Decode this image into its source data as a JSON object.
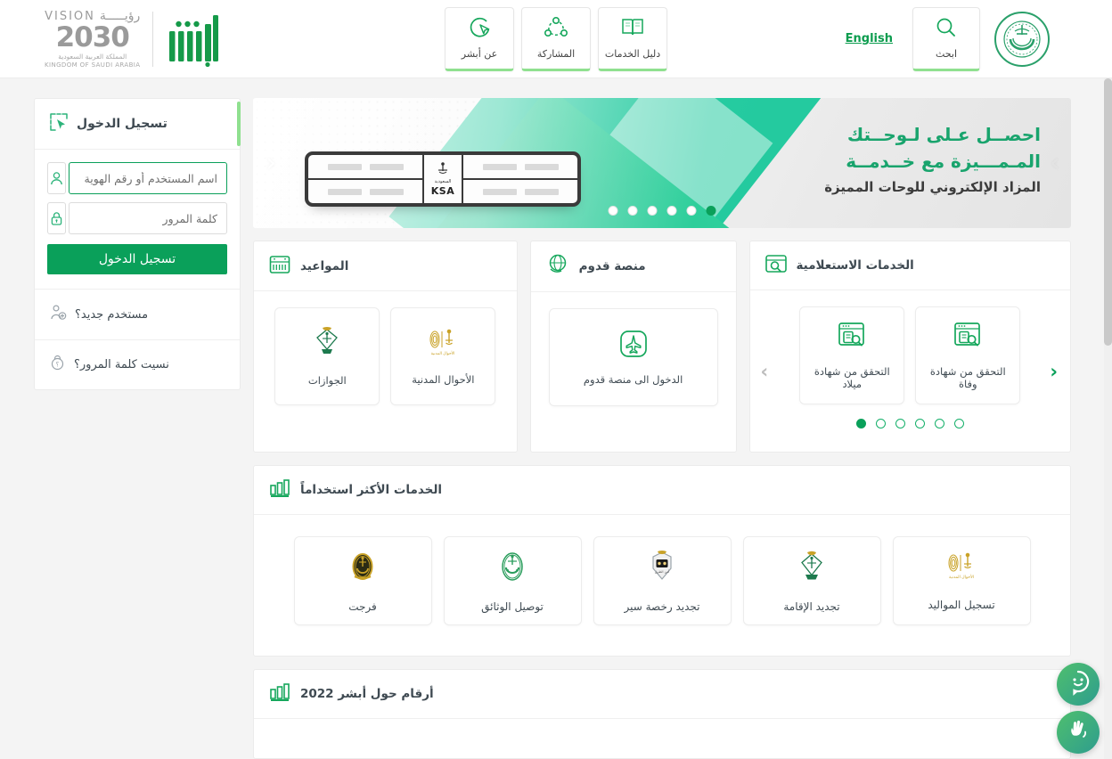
{
  "header": {
    "emblem_alt": "saudi-government-emblem",
    "search": {
      "label": "ابحث",
      "icon": "search-icon"
    },
    "language_toggle": "English",
    "nav_items": [
      {
        "label": "دليل الخدمات",
        "icon": "book-icon"
      },
      {
        "label": "المشاركة",
        "icon": "share-nodes-icon"
      },
      {
        "label": "عن أبشر",
        "icon": "cursor-circle-icon"
      }
    ],
    "vision": {
      "word_en": "VISION",
      "word_ar": "رؤيـــــة",
      "year": "2030",
      "kingdom_ar": "المملكة العربية السعودية",
      "kingdom_en": "KINGDOM OF SAUDI ARABIA"
    },
    "absher_logo_alt": "absher-logo"
  },
  "hero": {
    "title_green": "احصــل عـلى لـوحــتك المـمـــيزة مع خــدمــة",
    "title_dark": "المزاد الإلكتروني للوحات المميزة",
    "plate": {
      "country_ar": "السعودية",
      "country_en": "KSA"
    },
    "dots_count": 6,
    "active_dot": 0,
    "prev_label": "‹",
    "next_label": "›"
  },
  "cards": {
    "appointments": {
      "title": "المواعيد",
      "icon": "calendar-icon",
      "tiles": [
        {
          "label": "الأحوال المدنية",
          "icon": "civil-affairs-emblem"
        },
        {
          "label": "الجوازات",
          "icon": "passports-emblem"
        }
      ]
    },
    "qudoom": {
      "title": "منصة قدوم",
      "icon": "globe-hand-icon",
      "tiles": [
        {
          "label": "الدخول الى منصة قدوم",
          "icon": "airplane-icon"
        }
      ]
    },
    "inquiry": {
      "title": "الخدمات الاستعلامية",
      "icon": "browser-search-icon",
      "tiles": [
        {
          "label": "التحقق من شهادة وفاة",
          "icon": "document-search-icon"
        },
        {
          "label": "التحقق من شهادة ميلاد",
          "icon": "document-search-icon"
        }
      ],
      "dots_count": 6,
      "active_dot": 5,
      "prev_label": "‹",
      "next_label": "›"
    },
    "most_used": {
      "title": "الخدمات الأكثر استخداماً",
      "icon": "bar-chart-icon",
      "tiles": [
        {
          "label": "تسجيل المواليد",
          "icon": "civil-affairs-emblem"
        },
        {
          "label": "تجديد الإقامة",
          "icon": "passports-emblem"
        },
        {
          "label": "تجديد رخصة سير",
          "icon": "traffic-emblem"
        },
        {
          "label": "توصيل الوثائق",
          "icon": "interior-emblem"
        },
        {
          "label": "فرجت",
          "icon": "farajat-emblem"
        }
      ]
    },
    "stats": {
      "title": "أرقام حول أبشر 2022",
      "icon": "bar-chart-icon"
    }
  },
  "login": {
    "title": "تسجيل الدخول",
    "icon": "cursor-select-icon",
    "username": {
      "value": "",
      "placeholder": "اسم المستخدم أو رقم الهوية",
      "icon": "user-icon",
      "focused": true
    },
    "password": {
      "value": "",
      "placeholder": "كلمة المرور",
      "icon": "lock-icon",
      "focused": false
    },
    "submit_label": "تسجيل الدخول",
    "new_user_label": "مستخدم جديد؟",
    "new_user_icon": "user-plus-icon",
    "forgot_label": "نسيت كلمة المرور؟",
    "forgot_icon": "lock-question-icon"
  },
  "floating": [
    {
      "name": "chat-assistant-button",
      "icon": "smiley-chat-icon"
    },
    {
      "name": "sign-language-button",
      "icon": "hands-icon"
    }
  ],
  "colors": {
    "primary_green": "#0aa05a",
    "accent_light_green": "#8fe08f",
    "teal": "#19c89b",
    "text_dark": "#3f4a52",
    "page_bg": "#f4f4f4"
  }
}
